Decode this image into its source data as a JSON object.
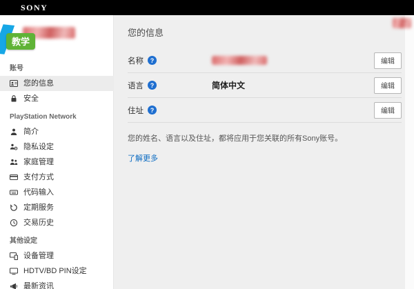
{
  "topbar": {
    "logo": "SONY"
  },
  "sidebar": {
    "badge": "教学",
    "sections": [
      {
        "title": "账号",
        "items": [
          {
            "label": "您的信息",
            "icon": "id-card-icon",
            "active": true
          },
          {
            "label": "安全",
            "icon": "lock-icon",
            "active": false
          }
        ]
      },
      {
        "title": "PlayStation Network",
        "items": [
          {
            "label": "简介",
            "icon": "profile-icon",
            "active": false
          },
          {
            "label": "隐私设定",
            "icon": "privacy-icon",
            "active": false
          },
          {
            "label": "家庭管理",
            "icon": "family-icon",
            "active": false
          },
          {
            "label": "支付方式",
            "icon": "payment-icon",
            "active": false
          },
          {
            "label": "代码输入",
            "icon": "code-input-icon",
            "active": false
          },
          {
            "label": "定期服务",
            "icon": "subscription-icon",
            "active": false
          },
          {
            "label": "交易历史",
            "icon": "history-icon",
            "active": false
          }
        ]
      },
      {
        "title": "其他设定",
        "items": [
          {
            "label": "设备管理",
            "icon": "devices-icon",
            "active": false
          },
          {
            "label": "HDTV/BD PIN设定",
            "icon": "tv-icon",
            "active": false
          },
          {
            "label": "最新资讯",
            "icon": "news-icon",
            "active": false
          }
        ]
      }
    ]
  },
  "main": {
    "title": "您的信息",
    "rows": [
      {
        "label": "名称",
        "help": "?",
        "value": "",
        "redacted": true,
        "edit": "编辑"
      },
      {
        "label": "语言",
        "help": "?",
        "value": "简体中文",
        "redacted": false,
        "edit": "编辑"
      },
      {
        "label": "住址",
        "help": "?",
        "value": "",
        "redacted": false,
        "edit": "编辑"
      }
    ],
    "note": "您的姓名、语言以及住址，都将应用于您关联的所有Sony账号。",
    "learn_more": "了解更多"
  },
  "colors": {
    "topbar_black": "#000000",
    "content_bg": "#efefef",
    "accent_blue": "#1f6fd0",
    "link_blue": "#0b6bc2",
    "badge_green": "#5fb336",
    "wedge_blue": "#17a7e6"
  }
}
